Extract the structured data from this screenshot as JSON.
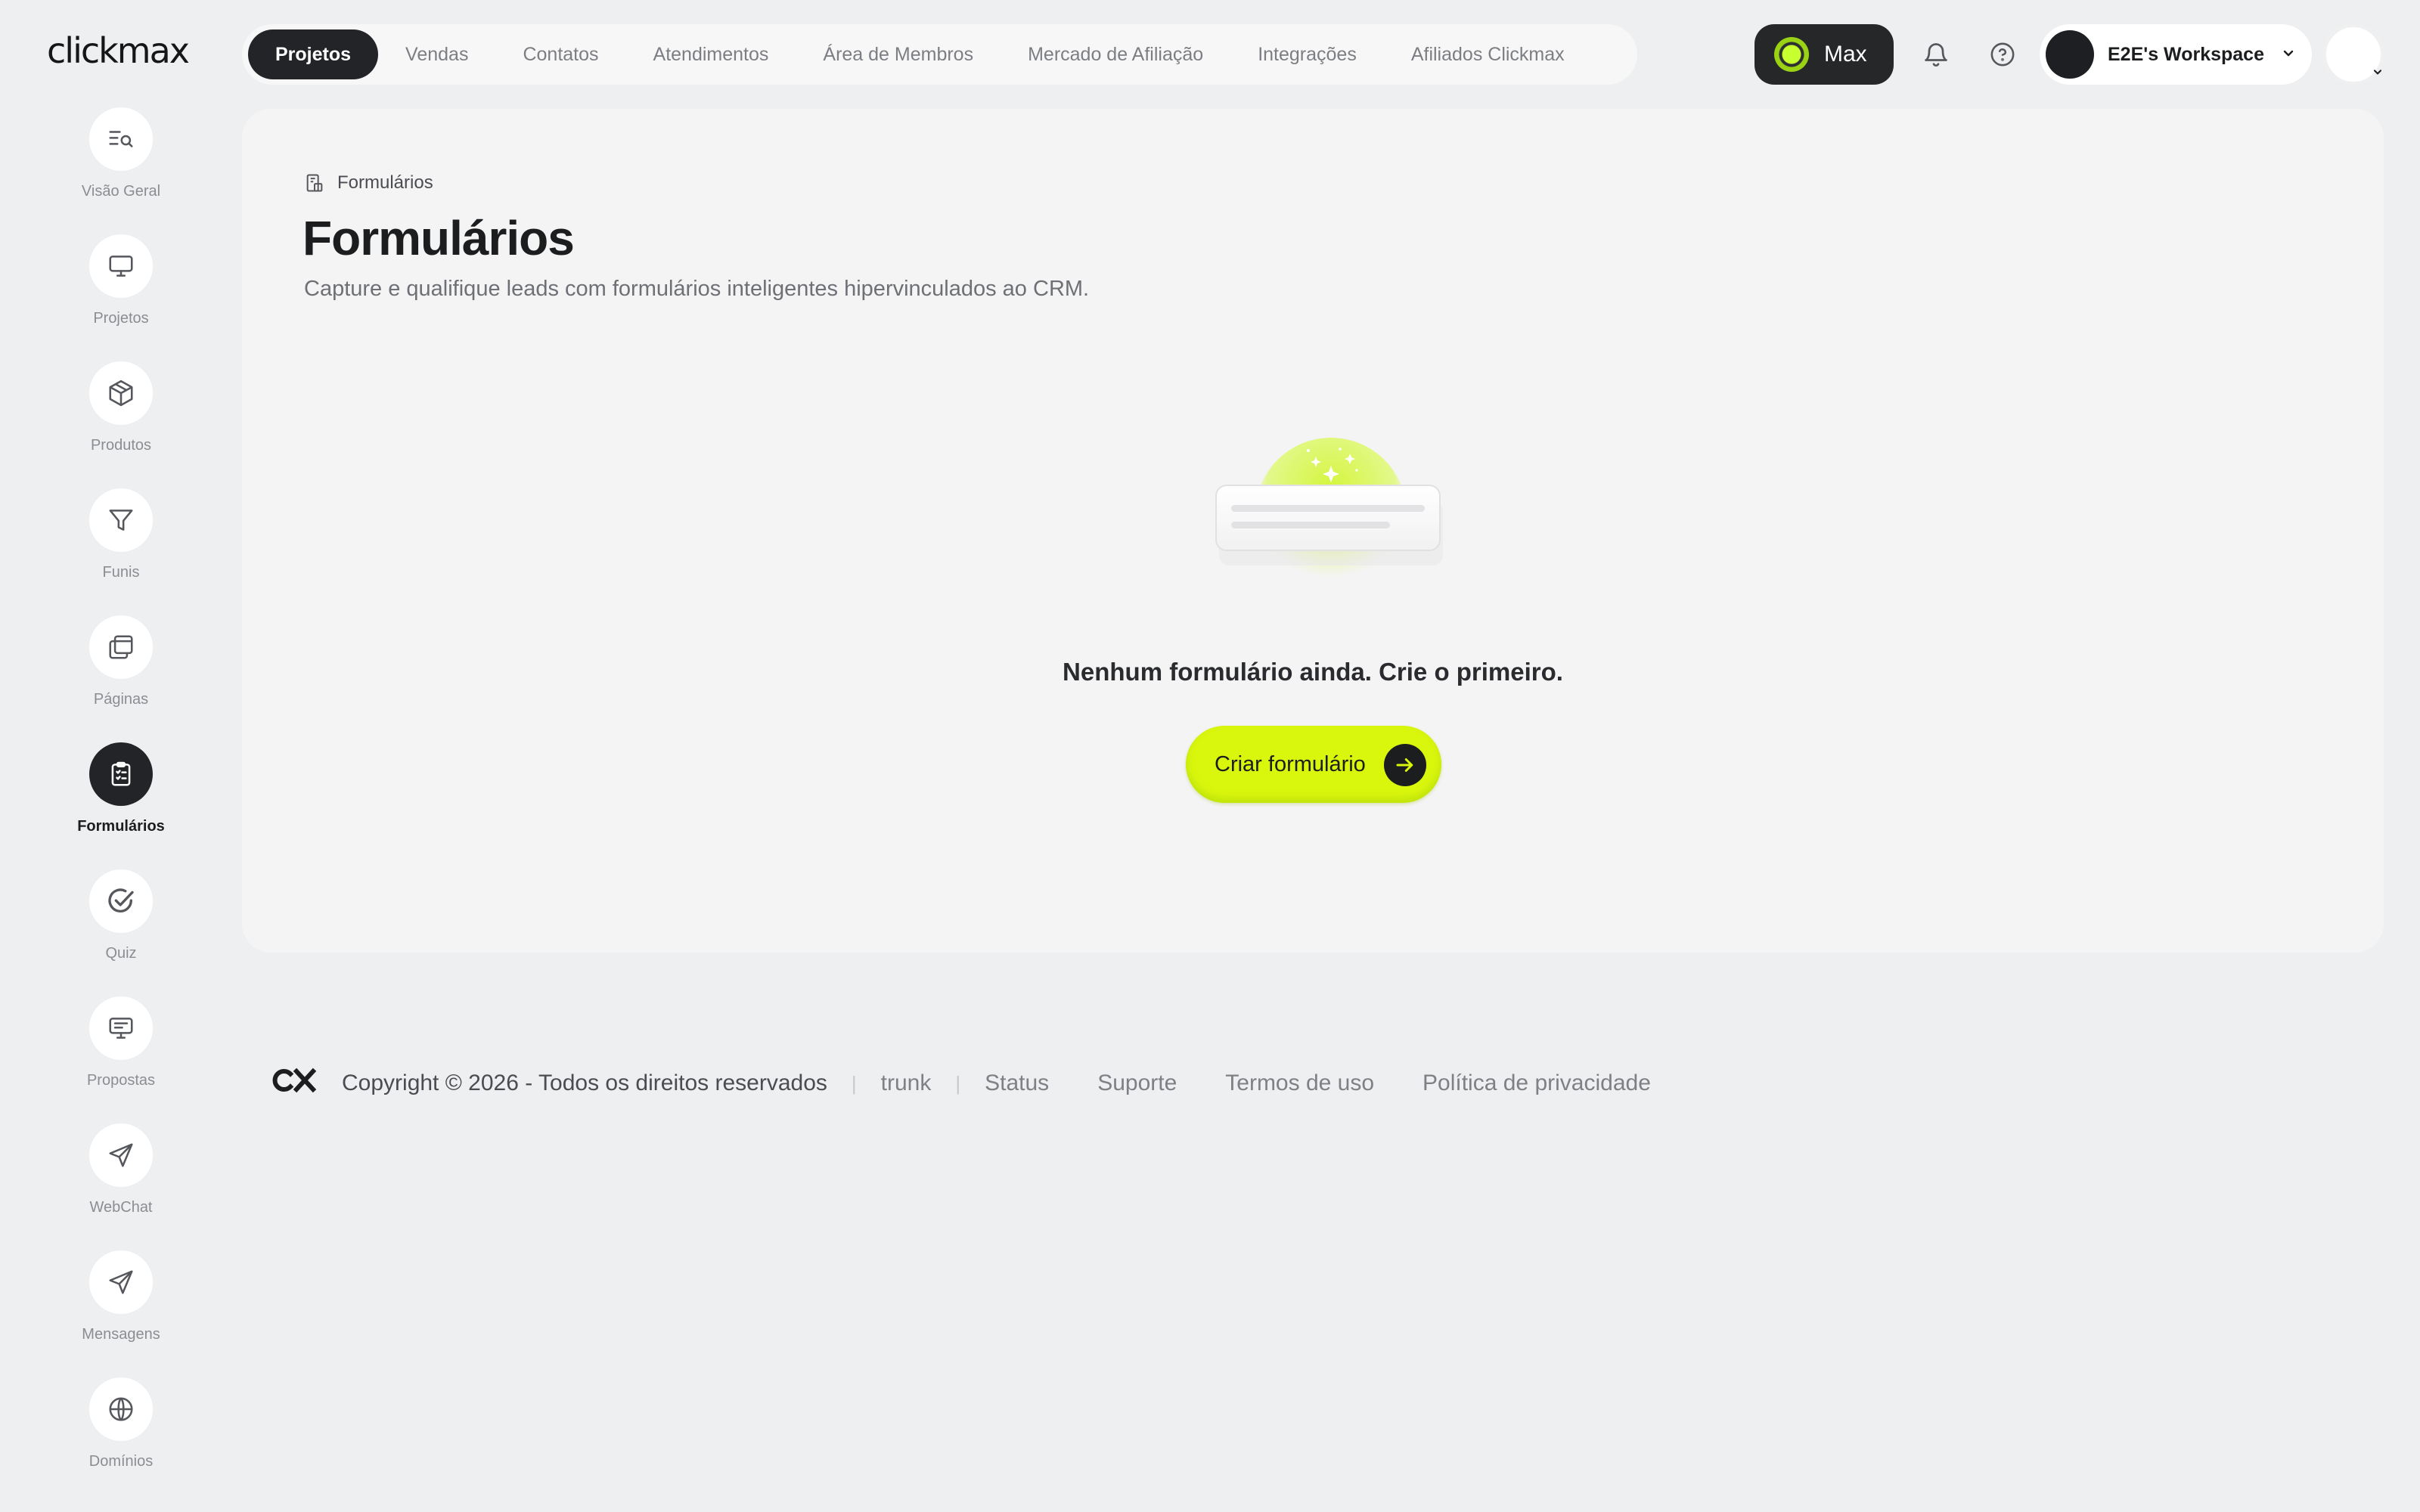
{
  "app": {
    "logo_text": "clickmax"
  },
  "topnav": {
    "tabs": [
      {
        "label": "Projetos",
        "active": true
      },
      {
        "label": "Vendas"
      },
      {
        "label": "Contatos"
      },
      {
        "label": "Atendimentos"
      },
      {
        "label": "Área de Membros"
      },
      {
        "label": "Mercado de Afiliação"
      },
      {
        "label": "Integrações"
      },
      {
        "label": "Afiliados Clickmax"
      }
    ],
    "max_label": "Max",
    "workspace_name": "E2E's Workspace",
    "icons": [
      "bell-icon",
      "help-circle-icon",
      "chevron-down-icon"
    ]
  },
  "sidebar": {
    "items": [
      {
        "label": "Visão Geral",
        "icon": "overview-search-icon"
      },
      {
        "label": "Projetos",
        "icon": "monitor-icon"
      },
      {
        "label": "Produtos",
        "icon": "box-icon"
      },
      {
        "label": "Funis",
        "icon": "funnel-icon"
      },
      {
        "label": "Páginas",
        "icon": "pages-icon"
      },
      {
        "label": "Formulários",
        "icon": "clipboard-list-icon",
        "active": true
      },
      {
        "label": "Quiz",
        "icon": "check-circle-icon"
      },
      {
        "label": "Propostas",
        "icon": "presentation-icon"
      },
      {
        "label": "WebChat",
        "icon": "send-icon"
      },
      {
        "label": "Mensagens",
        "icon": "send-icon"
      },
      {
        "label": "Domínios",
        "icon": "globe-icon"
      }
    ]
  },
  "main": {
    "breadcrumb": "Formulários",
    "title": "Formulários",
    "subtitle": "Capture e qualifique leads com formulários inteligentes hipervinculados ao CRM.",
    "empty_state": "Nenhum formulário ainda. Crie o primeiro.",
    "cta_label": "Criar formulário"
  },
  "footer": {
    "logo": "CX",
    "copyright": "Copyright © 2026 - Todos os direitos reservados",
    "branch": "trunk",
    "links": [
      "Status",
      "Suporte",
      "Termos de uso",
      "Política de privacidade"
    ]
  },
  "colors": {
    "accent_lime": "#d9f60d",
    "dark": "#232427",
    "background": "#eeeff0",
    "card": "#f4f4f5"
  }
}
